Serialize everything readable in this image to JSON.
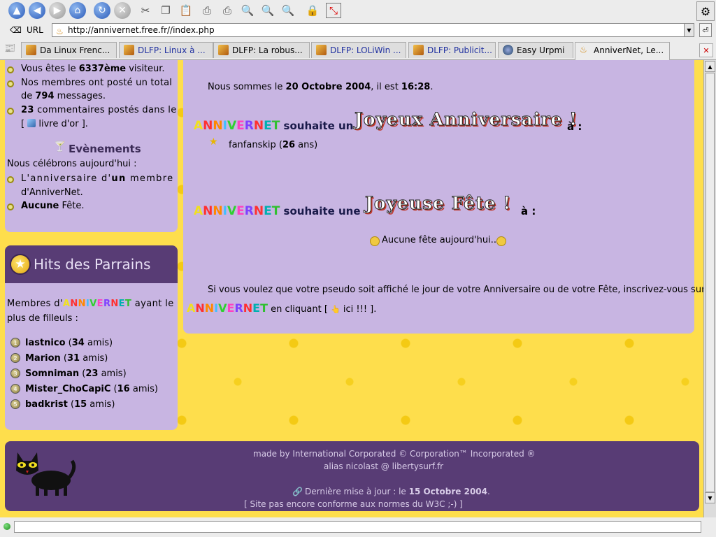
{
  "browser": {
    "url_label": "URL",
    "url": "http://annivernet.free.fr//index.php",
    "tabs": [
      {
        "label": "Da Linux Frenc..."
      },
      {
        "label": "DLFP: Linux à ..."
      },
      {
        "label": "DLFP: La robus..."
      },
      {
        "label": "DLFP: LOLiWin ..."
      },
      {
        "label": "DLFP: Publicit..."
      },
      {
        "label": "Easy Urpmi"
      },
      {
        "label": "AnniverNet, Le..."
      }
    ]
  },
  "sidebar_top": {
    "visitor_prefix": "Vous êtes le ",
    "visitor_rank": "6337ème",
    "visitor_suffix": " visiteur.",
    "posted_line1": "Nos membres ont posté un total",
    "posted_prefix": "de ",
    "posted_count": "794",
    "posted_suffix": " messages.",
    "comments_count": "23",
    "comments_text": " commentaires postés dans le",
    "guestbook_open": "[",
    "guestbook_label": "livre d'or",
    "guestbook_close": "].",
    "events_title": "Evènements",
    "today_text": "Nous célébrons aujourd'hui :",
    "anniv_line1_prefix": "L'anniversaire d'",
    "anniv_line1_bold": "un",
    "anniv_line1_suffix": " membre",
    "anniv_line2": "d'AnniverNet.",
    "fete_bold": "Aucune",
    "fete_text": " Fête."
  },
  "parrains": {
    "title": "Hits des Parrains",
    "intro_prefix": "Membres d'",
    "intro_suffix": " ayant le",
    "intro_line2": "plus de filleuls :",
    "list": [
      {
        "name": "lastnico",
        "count": "34",
        "unit": " amis)"
      },
      {
        "name": "Marion",
        "count": "31",
        "unit": " amis)"
      },
      {
        "name": "Somniman",
        "count": "23",
        "unit": " amis)"
      },
      {
        "name": "Mister_ChoCapiC",
        "count": "16",
        "unit": " amis)"
      },
      {
        "name": "badkrist",
        "count": "15",
        "unit": " amis)"
      }
    ]
  },
  "brand_letters": [
    "A",
    "N",
    "N",
    "I",
    "V",
    "E",
    "R",
    "N",
    "E",
    "T"
  ],
  "brand_colors": [
    "#f0e020",
    "#ff3030",
    "#ff8800",
    "#40c0ff",
    "#30d030",
    "#ff40c0",
    "#8040ff",
    "#ff3030",
    "#00b0b0",
    "#30c030"
  ],
  "main": {
    "date_prefix": "Nous sommes le ",
    "date": "20 Octobre 2004",
    "time_prefix": ", il est ",
    "time": "16:28",
    "time_suffix": ".",
    "wish_birthday": " souhaite un ",
    "fancy_birthday": "Joyeux Anniversaire !",
    "colon": " à :",
    "birthday_person": "fanfanskip",
    "birthday_age_prefix": " (",
    "birthday_age": "26",
    "birthday_age_suffix": " ans)",
    "wish_fete": " souhaite une ",
    "fancy_fete": "Joyeuse Fête !",
    "no_fete": "Aucune fête aujourd'hui...",
    "signup_line1": "Si vous voulez que votre pseudo soit affiché le jour de votre Anniversaire ou de votre Fête, inscrivez-vous sur",
    "signup_line2_mid": " en cliquant [ ",
    "signup_link": "ici !!!",
    "signup_line2_end": " ]."
  },
  "footer": {
    "made_by": "made by International Corporated © Corporation™ Incorporated ®",
    "alias": "alias nicolast @ libertysurf.fr",
    "update_prefix": "Dernière mise à jour : le ",
    "update_date": "15 Octobre 2004",
    "update_suffix": ".",
    "w3c": "[ Site pas encore conforme aux normes du W3C ;-) ]"
  }
}
